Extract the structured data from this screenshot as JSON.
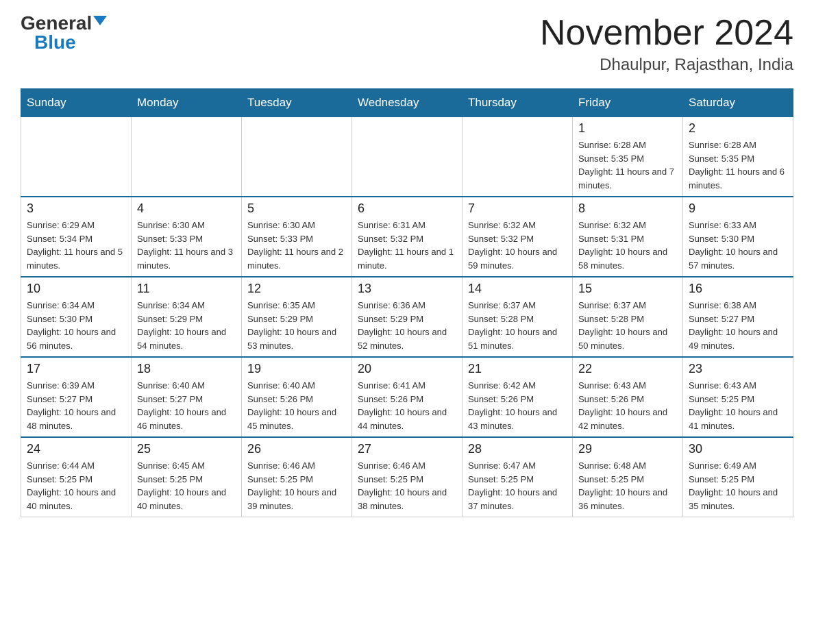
{
  "header": {
    "logo_general": "General",
    "logo_blue": "Blue",
    "month_title": "November 2024",
    "location": "Dhaulpur, Rajasthan, India"
  },
  "days_of_week": [
    "Sunday",
    "Monday",
    "Tuesday",
    "Wednesday",
    "Thursday",
    "Friday",
    "Saturday"
  ],
  "weeks": [
    {
      "days": [
        {
          "number": "",
          "info": ""
        },
        {
          "number": "",
          "info": ""
        },
        {
          "number": "",
          "info": ""
        },
        {
          "number": "",
          "info": ""
        },
        {
          "number": "",
          "info": ""
        },
        {
          "number": "1",
          "info": "Sunrise: 6:28 AM\nSunset: 5:35 PM\nDaylight: 11 hours and 7 minutes."
        },
        {
          "number": "2",
          "info": "Sunrise: 6:28 AM\nSunset: 5:35 PM\nDaylight: 11 hours and 6 minutes."
        }
      ]
    },
    {
      "days": [
        {
          "number": "3",
          "info": "Sunrise: 6:29 AM\nSunset: 5:34 PM\nDaylight: 11 hours and 5 minutes."
        },
        {
          "number": "4",
          "info": "Sunrise: 6:30 AM\nSunset: 5:33 PM\nDaylight: 11 hours and 3 minutes."
        },
        {
          "number": "5",
          "info": "Sunrise: 6:30 AM\nSunset: 5:33 PM\nDaylight: 11 hours and 2 minutes."
        },
        {
          "number": "6",
          "info": "Sunrise: 6:31 AM\nSunset: 5:32 PM\nDaylight: 11 hours and 1 minute."
        },
        {
          "number": "7",
          "info": "Sunrise: 6:32 AM\nSunset: 5:32 PM\nDaylight: 10 hours and 59 minutes."
        },
        {
          "number": "8",
          "info": "Sunrise: 6:32 AM\nSunset: 5:31 PM\nDaylight: 10 hours and 58 minutes."
        },
        {
          "number": "9",
          "info": "Sunrise: 6:33 AM\nSunset: 5:30 PM\nDaylight: 10 hours and 57 minutes."
        }
      ]
    },
    {
      "days": [
        {
          "number": "10",
          "info": "Sunrise: 6:34 AM\nSunset: 5:30 PM\nDaylight: 10 hours and 56 minutes."
        },
        {
          "number": "11",
          "info": "Sunrise: 6:34 AM\nSunset: 5:29 PM\nDaylight: 10 hours and 54 minutes."
        },
        {
          "number": "12",
          "info": "Sunrise: 6:35 AM\nSunset: 5:29 PM\nDaylight: 10 hours and 53 minutes."
        },
        {
          "number": "13",
          "info": "Sunrise: 6:36 AM\nSunset: 5:29 PM\nDaylight: 10 hours and 52 minutes."
        },
        {
          "number": "14",
          "info": "Sunrise: 6:37 AM\nSunset: 5:28 PM\nDaylight: 10 hours and 51 minutes."
        },
        {
          "number": "15",
          "info": "Sunrise: 6:37 AM\nSunset: 5:28 PM\nDaylight: 10 hours and 50 minutes."
        },
        {
          "number": "16",
          "info": "Sunrise: 6:38 AM\nSunset: 5:27 PM\nDaylight: 10 hours and 49 minutes."
        }
      ]
    },
    {
      "days": [
        {
          "number": "17",
          "info": "Sunrise: 6:39 AM\nSunset: 5:27 PM\nDaylight: 10 hours and 48 minutes."
        },
        {
          "number": "18",
          "info": "Sunrise: 6:40 AM\nSunset: 5:27 PM\nDaylight: 10 hours and 46 minutes."
        },
        {
          "number": "19",
          "info": "Sunrise: 6:40 AM\nSunset: 5:26 PM\nDaylight: 10 hours and 45 minutes."
        },
        {
          "number": "20",
          "info": "Sunrise: 6:41 AM\nSunset: 5:26 PM\nDaylight: 10 hours and 44 minutes."
        },
        {
          "number": "21",
          "info": "Sunrise: 6:42 AM\nSunset: 5:26 PM\nDaylight: 10 hours and 43 minutes."
        },
        {
          "number": "22",
          "info": "Sunrise: 6:43 AM\nSunset: 5:26 PM\nDaylight: 10 hours and 42 minutes."
        },
        {
          "number": "23",
          "info": "Sunrise: 6:43 AM\nSunset: 5:25 PM\nDaylight: 10 hours and 41 minutes."
        }
      ]
    },
    {
      "days": [
        {
          "number": "24",
          "info": "Sunrise: 6:44 AM\nSunset: 5:25 PM\nDaylight: 10 hours and 40 minutes."
        },
        {
          "number": "25",
          "info": "Sunrise: 6:45 AM\nSunset: 5:25 PM\nDaylight: 10 hours and 40 minutes."
        },
        {
          "number": "26",
          "info": "Sunrise: 6:46 AM\nSunset: 5:25 PM\nDaylight: 10 hours and 39 minutes."
        },
        {
          "number": "27",
          "info": "Sunrise: 6:46 AM\nSunset: 5:25 PM\nDaylight: 10 hours and 38 minutes."
        },
        {
          "number": "28",
          "info": "Sunrise: 6:47 AM\nSunset: 5:25 PM\nDaylight: 10 hours and 37 minutes."
        },
        {
          "number": "29",
          "info": "Sunrise: 6:48 AM\nSunset: 5:25 PM\nDaylight: 10 hours and 36 minutes."
        },
        {
          "number": "30",
          "info": "Sunrise: 6:49 AM\nSunset: 5:25 PM\nDaylight: 10 hours and 35 minutes."
        }
      ]
    }
  ]
}
